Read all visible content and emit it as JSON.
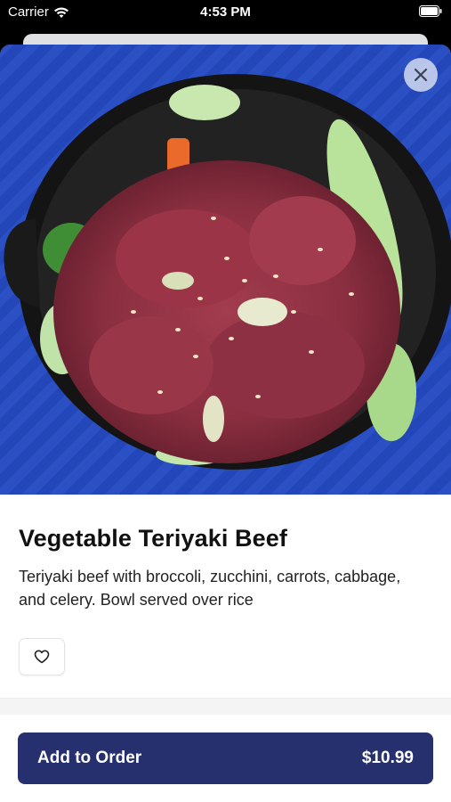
{
  "status_bar": {
    "carrier": "Carrier",
    "time": "4:53 PM"
  },
  "item": {
    "image_icon": "teriyaki-beef-bowl-photo",
    "title": "Vegetable Teriyaki Beef",
    "description": "Teriyaki beef with broccoli, zucchini, carrots, cabbage, and celery. Bowl served over rice"
  },
  "actions": {
    "close_icon": "close-icon",
    "favorite_icon": "heart-icon",
    "add_to_order_label": "Add to Order",
    "price": "$10.99"
  },
  "colors": {
    "primary_button": "#26306e",
    "hero_background": "#2346b8"
  }
}
